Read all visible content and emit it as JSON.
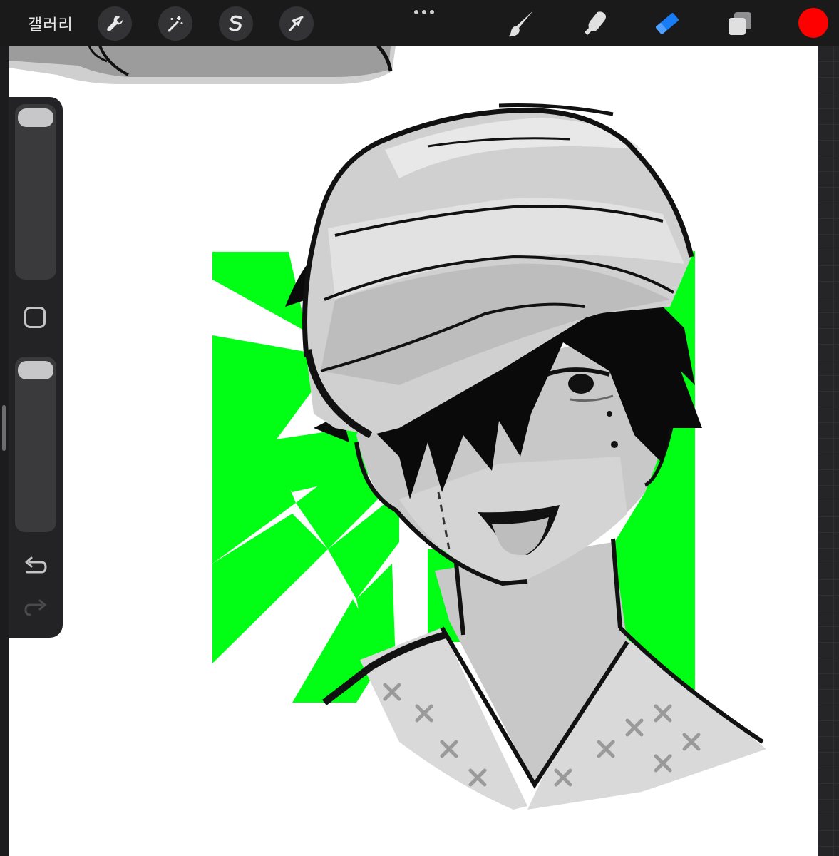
{
  "toolbar": {
    "gallery_label": "갤러리",
    "left_tools": [
      "wrench-icon",
      "magic-wand-icon",
      "selection-s-icon",
      "transform-arrow-icon"
    ],
    "right_tools": [
      "brush-icon",
      "smudge-icon",
      "eraser-icon",
      "layers-icon"
    ],
    "active_tool": "eraser",
    "active_tool_color": "#1a7cf5",
    "current_color": "#ff0000"
  },
  "sidebar": {
    "brush_size_level": 1.0,
    "opacity_level": 1.0,
    "modify_button": "square-icon",
    "undo": "undo-icon",
    "redo": "redo-icon",
    "redo_enabled": false
  },
  "canvas": {
    "background": "#ffffff",
    "accent_green": "#00ff15",
    "artwork": "character-illustration"
  }
}
